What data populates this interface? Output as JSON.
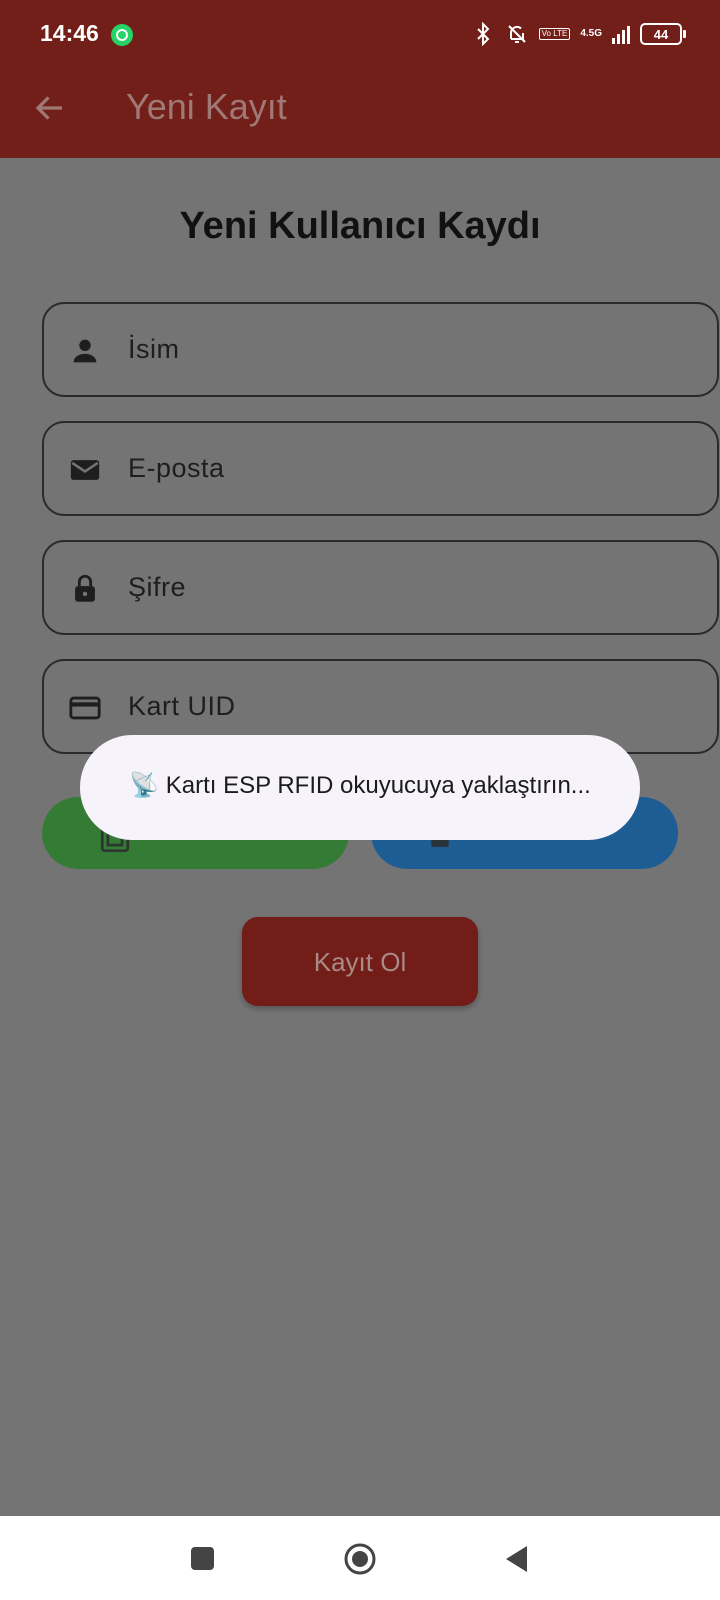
{
  "status_bar": {
    "time": "14:46",
    "network_label": "4.5G",
    "volte_label": "Vo LTE",
    "battery_level": "44",
    "icons": [
      "whatsapp-icon",
      "bluetooth-icon",
      "bell-off-icon",
      "signal-icon",
      "battery-icon"
    ]
  },
  "app_bar": {
    "title": "Yeni Kayıt",
    "back_icon": "arrow-left-icon"
  },
  "form": {
    "heading": "Yeni Kullanıcı Kaydı",
    "fields": [
      {
        "placeholder": "İsim",
        "icon": "person-icon"
      },
      {
        "placeholder": "E-posta",
        "icon": "mail-icon"
      },
      {
        "placeholder": "Şifre",
        "icon": "lock-icon"
      },
      {
        "placeholder": "Kart UID",
        "icon": "credit-card-icon"
      }
    ],
    "register_button": "Kayıt Ol"
  },
  "toast": {
    "message": "📡 Kartı ESP RFID okuyucuya yaklaştırın..."
  },
  "colors": {
    "app_bar": "#721f19",
    "overlay_background": "#747474",
    "green_button": "#347c36",
    "blue_button": "#1d5d93",
    "register_button": "#731d19",
    "toast_background": "#f7f3fa"
  },
  "nav_bar": {
    "icons": [
      "recents-square-icon",
      "home-circle-icon",
      "back-triangle-icon"
    ]
  }
}
